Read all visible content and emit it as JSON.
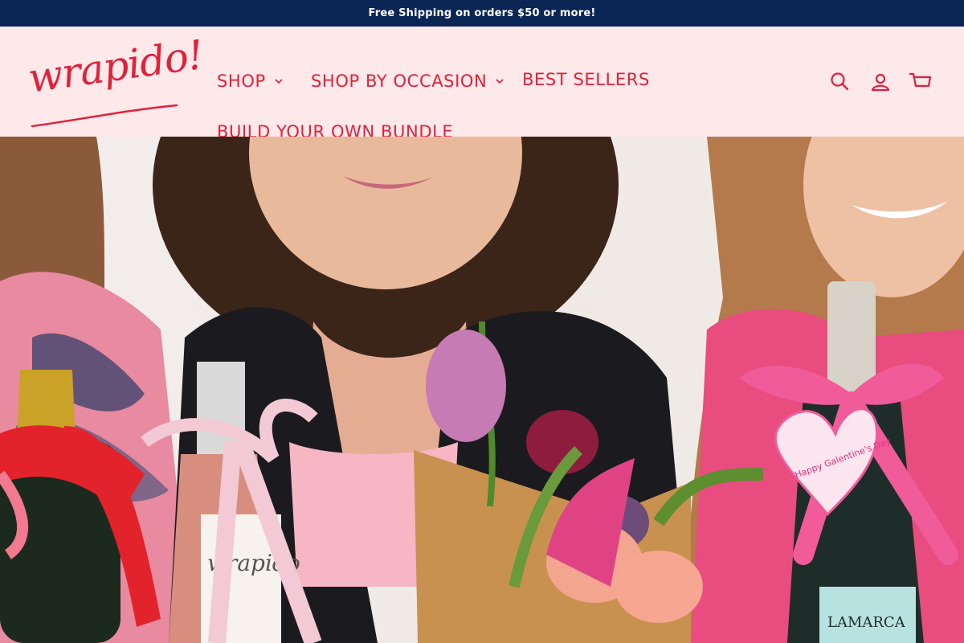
{
  "announcement": {
    "text": "Free Shipping on orders $50 or more!"
  },
  "brand": {
    "logo_text": "wrapido!",
    "accent_color": "#e0213a",
    "header_bg": "#fde8ea",
    "bar_bg": "#0b2554"
  },
  "nav": {
    "items": [
      {
        "label": "SHOP",
        "has_dropdown": true
      },
      {
        "label": "SHOP BY OCCASION",
        "has_dropdown": true
      },
      {
        "label": "BEST SELLERS",
        "has_dropdown": false
      },
      {
        "label": "BUILD YOUR OWN BUNDLE",
        "has_dropdown": false
      }
    ]
  },
  "header_icons": {
    "search": "search-icon",
    "account": "account-icon",
    "cart": "cart-icon"
  },
  "hero": {
    "tag_text": "Happy Galentine's Day",
    "bottle_label_left": "wrapido",
    "bottle_label_right": "LAMARCA"
  }
}
